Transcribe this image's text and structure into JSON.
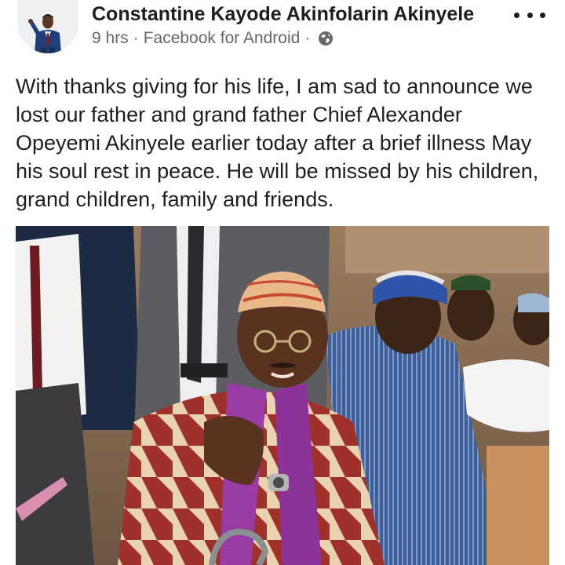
{
  "post": {
    "author": "Constantine Kayode Akinfolarin Akinyele",
    "time": "9 hrs",
    "separator": "·",
    "source": "Facebook for Android",
    "privacy_icon": "globe-icon",
    "more_icon": "more-options-icon",
    "text": "With thanks giving for his life, I am sad to announce we lost our father and grand father Chief Alexander Opeyemi Akinyele earlier today after a brief illness May his soul rest in peace. He will be missed by his children, grand children, family and friends."
  },
  "colors": {
    "text": "#1c1e21",
    "secondary_text": "#65676b",
    "background": "#ffffff"
  }
}
